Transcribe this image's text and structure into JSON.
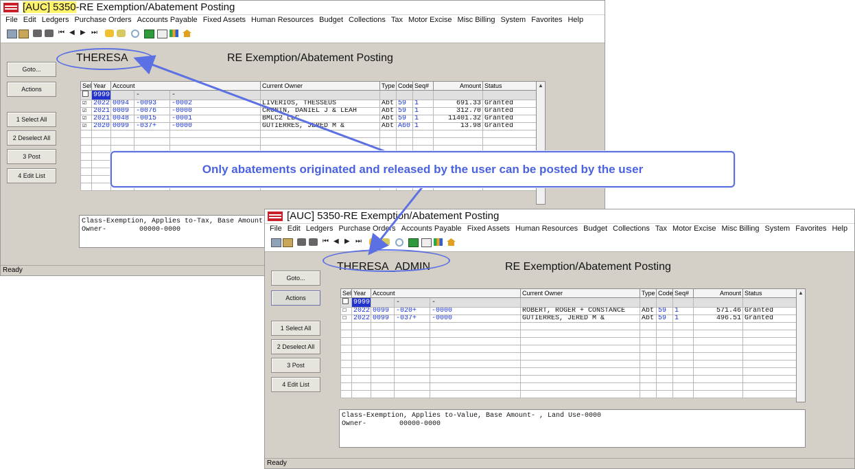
{
  "windows": [
    {
      "title_prefix": "[AUC] 5350",
      "title_suffix": "-RE Exemption/Abatement Posting",
      "menu": [
        "File",
        "Edit",
        "Ledgers",
        "Purchase Orders",
        "Accounts Payable",
        "Fixed Assets",
        "Human Resources",
        "Budget",
        "Collections",
        "Tax",
        "Motor Excise",
        "Misc Billing",
        "System",
        "Favorites",
        "Help"
      ],
      "user": "THERESA",
      "screen_title": "RE Exemption/Abatement Posting",
      "buttons": [
        "Goto...",
        "Actions",
        "1 Select All",
        "2 Deselect All",
        "3 Post",
        "4 Edit List"
      ],
      "columns": [
        "Sel",
        "Year",
        "Account",
        "",
        "",
        "Current Owner",
        "Type",
        "Code",
        "Seq#",
        "Amount",
        "Status"
      ],
      "filter": {
        "year": "9999",
        "acct1": "",
        "acct2": "-",
        "acct3": "-"
      },
      "rows": [
        {
          "sel": "☑",
          "year": "2022",
          "acct1": "0094",
          "acct2": "-0093",
          "acct3": "-0002",
          "owner": "LIVERIOS, THESSEUS",
          "type": "Abt",
          "code": "59",
          "seq": "1",
          "amount": "691.33",
          "status": "Granted"
        },
        {
          "sel": "☑",
          "year": "2021",
          "acct1": "0009",
          "acct2": "-0076",
          "acct3": "-0000",
          "owner": "CRONIN, DANIEL J & LEAH",
          "type": "Abt",
          "code": "59",
          "seq": "1",
          "amount": "312.70",
          "status": "Granted"
        },
        {
          "sel": "☑",
          "year": "2021",
          "acct1": "0048",
          "acct2": "-0015",
          "acct3": "-0001",
          "owner": "BMLC2 LLC",
          "type": "Abt",
          "code": "59",
          "seq": "1",
          "amount": "11401.32",
          "status": "Granted"
        },
        {
          "sel": "☑",
          "year": "2020",
          "acct1": "0099",
          "acct2": "-037+",
          "acct3": "-0000",
          "owner": "GUTIERRES, JERED M &",
          "type": "Abt",
          "code": "A60",
          "seq": "1",
          "amount": "13.98",
          "status": "Granted"
        }
      ],
      "info_line1": "Class-Exemption, Applies to-Tax, Base Amount- ,",
      "info_line2": "Owner-        00000-0000",
      "status": "Ready"
    },
    {
      "title_prefix": "[AUC] 5350",
      "title_suffix": "-RE Exemption/Abatement Posting",
      "menu": [
        "File",
        "Edit",
        "Ledgers",
        "Purchase Orders",
        "Accounts Payable",
        "Fixed Assets",
        "Human Resources",
        "Budget",
        "Collections",
        "Tax",
        "Motor Excise",
        "Misc Billing",
        "System",
        "Favorites",
        "Help"
      ],
      "user": "THERESA_ADMIN",
      "screen_title": "RE Exemption/Abatement Posting",
      "buttons": [
        "Goto...",
        "Actions",
        "1 Select All",
        "2 Deselect All",
        "3 Post",
        "4 Edit List"
      ],
      "columns": [
        "Sel",
        "Year",
        "Account",
        "",
        "",
        "Current Owner",
        "Type",
        "Code",
        "Seq#",
        "Amount",
        "Status"
      ],
      "filter": {
        "year": "9999",
        "acct1": "",
        "acct2": "-",
        "acct3": "-"
      },
      "rows": [
        {
          "sel": "☐",
          "year": "2022",
          "acct1": "0099",
          "acct2": "-020+",
          "acct3": "-0000",
          "owner": "ROBERT, ROGER + CONSTANCE",
          "type": "Abt",
          "code": "59",
          "seq": "1",
          "amount": "571.46",
          "status": "Granted"
        },
        {
          "sel": "☐",
          "year": "2022",
          "acct1": "0099",
          "acct2": "-037+",
          "acct3": "-0000",
          "owner": "GUTIERRES, JERED M &",
          "type": "Abt",
          "code": "59",
          "seq": "1",
          "amount": "496.51",
          "status": "Granted"
        }
      ],
      "info_line1": "Class-Exemption, Applies to-Value, Base Amount- , Land Use-0000",
      "info_line2": "Owner-        00000-0000",
      "status": "Ready"
    }
  ],
  "callout": {
    "text": "Only abatements originated and released by the user can be posted by the user"
  },
  "colors": {
    "accent": "#4a62de",
    "logo": "#c8202a",
    "highlight": "#fff36b",
    "filter_year": "#2233cc"
  }
}
